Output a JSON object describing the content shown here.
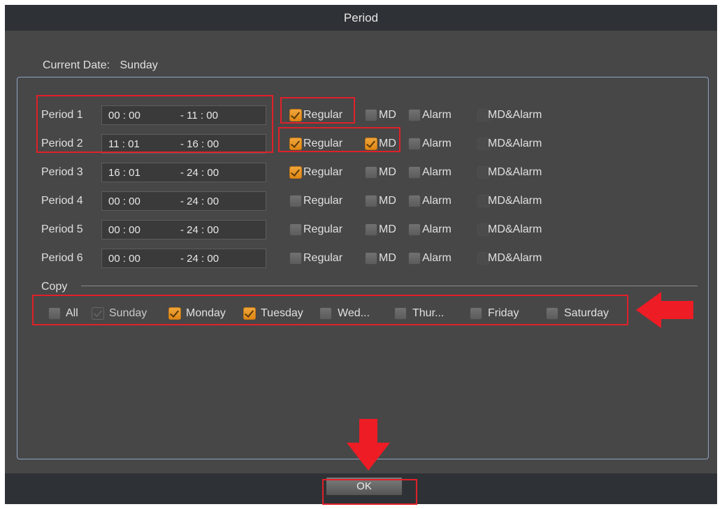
{
  "dialog": {
    "title": "Period"
  },
  "current_date": {
    "label": "Current Date:",
    "value": "Sunday"
  },
  "periods": [
    {
      "label": "Period 1",
      "start": "00 : 00",
      "end": "- 11 : 00",
      "regular": true,
      "md": false,
      "alarm": false,
      "md_alarm": false
    },
    {
      "label": "Period 2",
      "start": "11 : 01",
      "end": "- 16 : 00",
      "regular": true,
      "md": true,
      "alarm": false,
      "md_alarm": false
    },
    {
      "label": "Period 3",
      "start": "16 : 01",
      "end": "- 24 : 00",
      "regular": true,
      "md": false,
      "alarm": false,
      "md_alarm": false
    },
    {
      "label": "Period 4",
      "start": "00 : 00",
      "end": "- 24 : 00",
      "regular": false,
      "md": false,
      "alarm": false,
      "md_alarm": false
    },
    {
      "label": "Period 5",
      "start": "00 : 00",
      "end": "- 24 : 00",
      "regular": false,
      "md": false,
      "alarm": false,
      "md_alarm": false
    },
    {
      "label": "Period 6",
      "start": "00 : 00",
      "end": "- 24 : 00",
      "regular": false,
      "md": false,
      "alarm": false,
      "md_alarm": false
    }
  ],
  "record_types": {
    "regular": "Regular",
    "md": "MD",
    "alarm": "Alarm",
    "md_alarm": "MD&Alarm"
  },
  "copy": {
    "label": "Copy",
    "days": [
      {
        "label": "All",
        "state": "unchecked"
      },
      {
        "label": "Sunday",
        "state": "disabled"
      },
      {
        "label": "Monday",
        "state": "checked"
      },
      {
        "label": "Tuesday",
        "state": "checked"
      },
      {
        "label": "Wed...",
        "state": "unchecked"
      },
      {
        "label": "Thur...",
        "state": "unchecked"
      },
      {
        "label": "Friday",
        "state": "unchecked"
      },
      {
        "label": "Saturday",
        "state": "unchecked"
      }
    ]
  },
  "footer": {
    "ok_label": "OK"
  },
  "colors": {
    "highlight": "#e0202a",
    "checked": "#f0a43a",
    "background": "#474747"
  }
}
